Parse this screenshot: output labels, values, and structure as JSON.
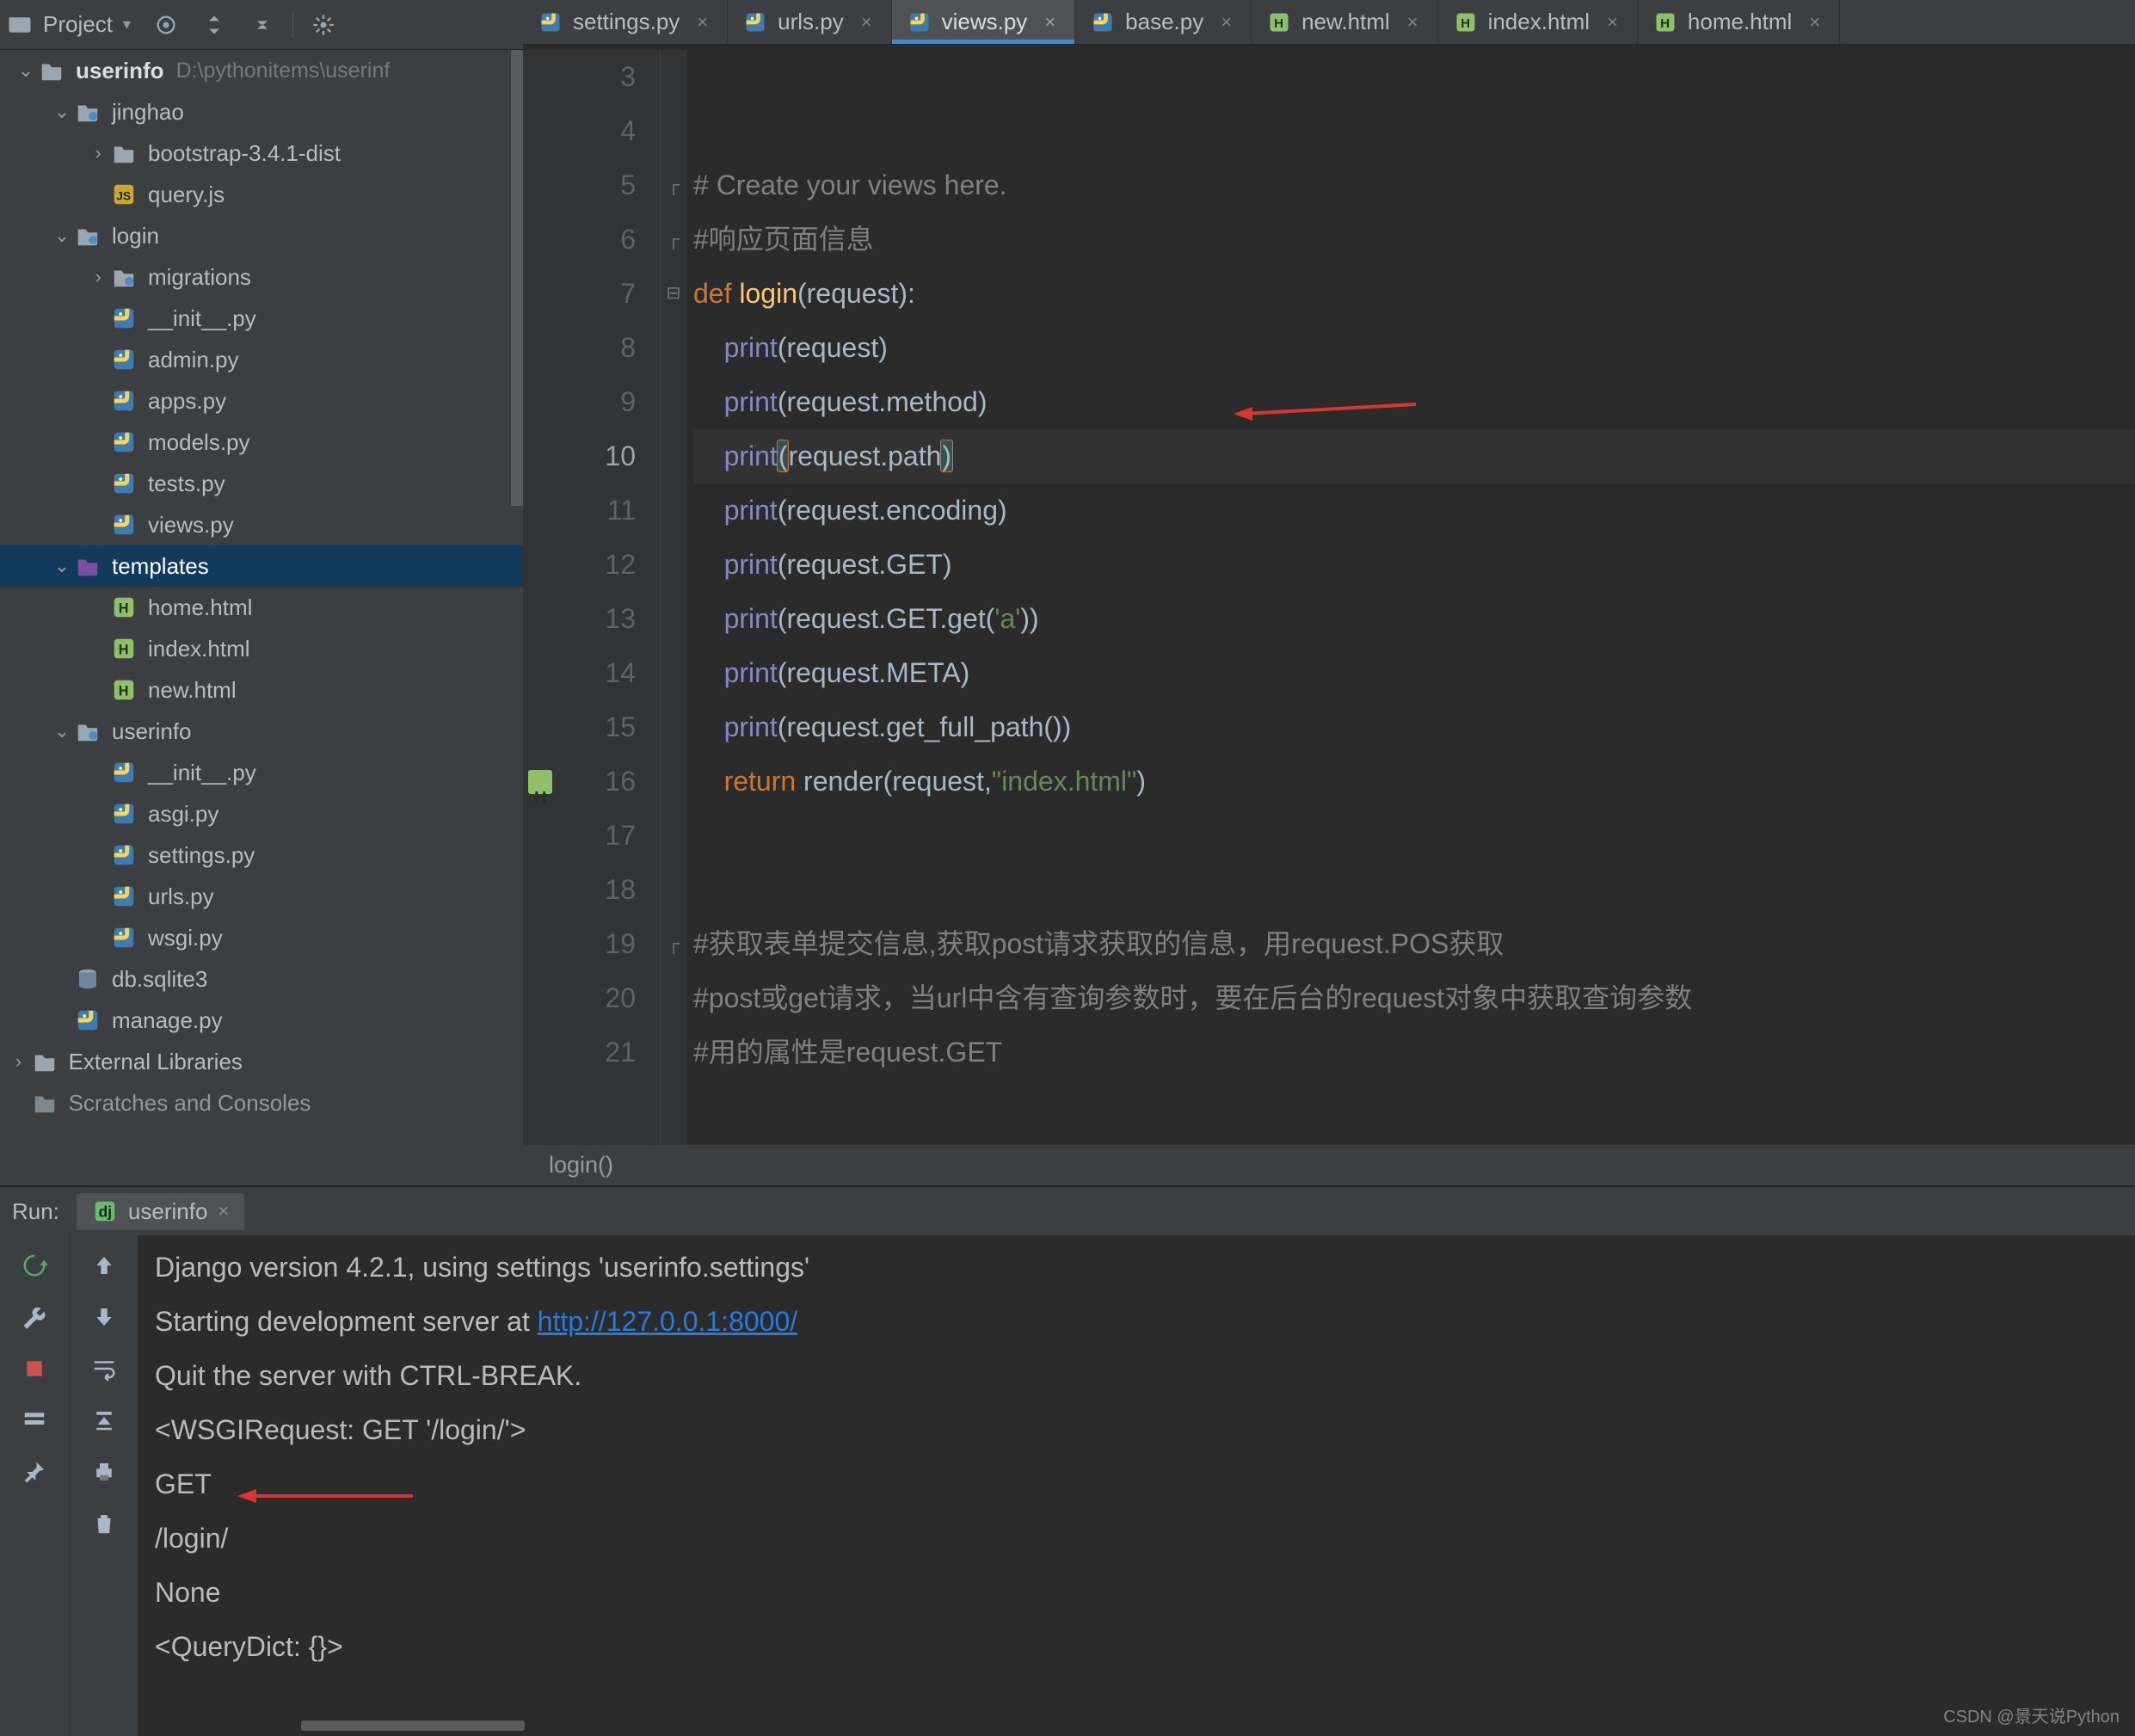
{
  "toolbar": {
    "project_label": "Project"
  },
  "tabs": [
    {
      "label": "settings.py",
      "icon": "py",
      "active": false
    },
    {
      "label": "urls.py",
      "icon": "py",
      "active": false
    },
    {
      "label": "views.py",
      "icon": "py",
      "active": true
    },
    {
      "label": "base.py",
      "icon": "py",
      "active": false
    },
    {
      "label": "new.html",
      "icon": "html",
      "active": false
    },
    {
      "label": "index.html",
      "icon": "html",
      "active": false
    },
    {
      "label": "home.html",
      "icon": "html",
      "active": false
    }
  ],
  "tree": {
    "root_name": "userinfo",
    "root_path": "D:\\pythonitems\\userinf",
    "items": [
      {
        "indent": 1,
        "arrow": "open",
        "kind": "dir-pkg",
        "name": "jinghao"
      },
      {
        "indent": 2,
        "arrow": "closed",
        "kind": "dir",
        "name": "bootstrap-3.4.1-dist"
      },
      {
        "indent": 2,
        "arrow": "none",
        "kind": "js",
        "name": "query.js"
      },
      {
        "indent": 1,
        "arrow": "open",
        "kind": "dir-pkg",
        "name": "login"
      },
      {
        "indent": 2,
        "arrow": "closed",
        "kind": "dir-pkg",
        "name": "migrations"
      },
      {
        "indent": 2,
        "arrow": "none",
        "kind": "py",
        "name": "__init__.py"
      },
      {
        "indent": 2,
        "arrow": "none",
        "kind": "py",
        "name": "admin.py"
      },
      {
        "indent": 2,
        "arrow": "none",
        "kind": "py",
        "name": "apps.py"
      },
      {
        "indent": 2,
        "arrow": "none",
        "kind": "py",
        "name": "models.py"
      },
      {
        "indent": 2,
        "arrow": "none",
        "kind": "py",
        "name": "tests.py"
      },
      {
        "indent": 2,
        "arrow": "none",
        "kind": "py",
        "name": "views.py"
      },
      {
        "indent": 1,
        "arrow": "open",
        "kind": "dir-tpl",
        "name": "templates",
        "selected": true
      },
      {
        "indent": 2,
        "arrow": "none",
        "kind": "html",
        "name": "home.html"
      },
      {
        "indent": 2,
        "arrow": "none",
        "kind": "html",
        "name": "index.html"
      },
      {
        "indent": 2,
        "arrow": "none",
        "kind": "html",
        "name": "new.html"
      },
      {
        "indent": 1,
        "arrow": "open",
        "kind": "dir-pkg",
        "name": "userinfo"
      },
      {
        "indent": 2,
        "arrow": "none",
        "kind": "py",
        "name": "__init__.py"
      },
      {
        "indent": 2,
        "arrow": "none",
        "kind": "py",
        "name": "asgi.py"
      },
      {
        "indent": 2,
        "arrow": "none",
        "kind": "py",
        "name": "settings.py"
      },
      {
        "indent": 2,
        "arrow": "none",
        "kind": "py",
        "name": "urls.py"
      },
      {
        "indent": 2,
        "arrow": "none",
        "kind": "py",
        "name": "wsgi.py"
      },
      {
        "indent": 1,
        "arrow": "none",
        "kind": "db",
        "name": "db.sqlite3"
      },
      {
        "indent": 1,
        "arrow": "none",
        "kind": "py",
        "name": "manage.py"
      }
    ],
    "external": "External Libraries",
    "scratches": "Scratches and Consoles"
  },
  "editor": {
    "first_line": 3,
    "current_line": 10,
    "breadcrumb": "login()",
    "lines": [
      {
        "n": 3,
        "html": ""
      },
      {
        "n": 4,
        "html": ""
      },
      {
        "n": 5,
        "html": "<span class='tok-comment'># Create your views here.</span>",
        "fold": "["
      },
      {
        "n": 6,
        "html": "<span class='tok-comment'>#响应页面信息</span>",
        "fold": "["
      },
      {
        "n": 7,
        "html": "<span class='tok-kw'>def </span><span class='tok-fn'>login</span><span class='tok-default'>(request):</span>",
        "fold": "-"
      },
      {
        "n": 8,
        "html": "    <span class='tok-builtin'>print</span><span class='tok-default'>(request)</span>"
      },
      {
        "n": 9,
        "html": "    <span class='tok-builtin'>print</span><span class='tok-default'>(request.method)</span>",
        "arrow": true
      },
      {
        "n": 10,
        "html": "    <span class='tok-builtin'>print</span><span class='tok-default paren-match'>(</span><span class='tok-default'>request.path</span><span class='tok-default paren-match'>)</span>"
      },
      {
        "n": 11,
        "html": "    <span class='tok-builtin'>print</span><span class='tok-default'>(request.encoding)</span>"
      },
      {
        "n": 12,
        "html": "    <span class='tok-builtin'>print</span><span class='tok-default'>(request.GET)</span>"
      },
      {
        "n": 13,
        "html": "    <span class='tok-builtin'>print</span><span class='tok-default'>(request.GET.get(</span><span class='tok-str'>'a'</span><span class='tok-default'>))</span>"
      },
      {
        "n": 14,
        "html": "    <span class='tok-builtin'>print</span><span class='tok-default'>(request.META)</span>"
      },
      {
        "n": 15,
        "html": "    <span class='tok-builtin'>print</span><span class='tok-default'>(request.get_full_path())</span>"
      },
      {
        "n": 16,
        "html": "    <span class='tok-kw'>return </span><span class='tok-default'>render(request,</span><span class='tok-str'>\"index.html\"</span><span class='tok-default'>)</span>",
        "badge": true
      },
      {
        "n": 17,
        "html": ""
      },
      {
        "n": 18,
        "html": ""
      },
      {
        "n": 19,
        "html": "<span class='tok-comment'>#获取表单提交信息,获取post请求获取的信息，用request.POS获取</span>",
        "fold": "["
      },
      {
        "n": 20,
        "html": "<span class='tok-comment'>#post或get请求，当url中含有查询参数时，要在后台的request对象中获取查询参数</span>"
      },
      {
        "n": 21,
        "html": "<span class='tok-comment'>#用的属性是request.GET</span>"
      }
    ]
  },
  "run": {
    "label": "Run:",
    "tab_name": "userinfo",
    "lines": [
      "Django version 4.2.1, using settings 'userinfo.settings'",
      "Starting development server at <a href='#'>http://127.0.0.1:8000/</a>",
      "Quit the server with CTRL-BREAK.",
      "",
      "<WSGIRequest: GET '/login/'>",
      "GET",
      "/login/",
      "None",
      "<QueryDict: {}>"
    ],
    "arrow_line_index": 5
  },
  "watermark": "CSDN @景天说Python"
}
